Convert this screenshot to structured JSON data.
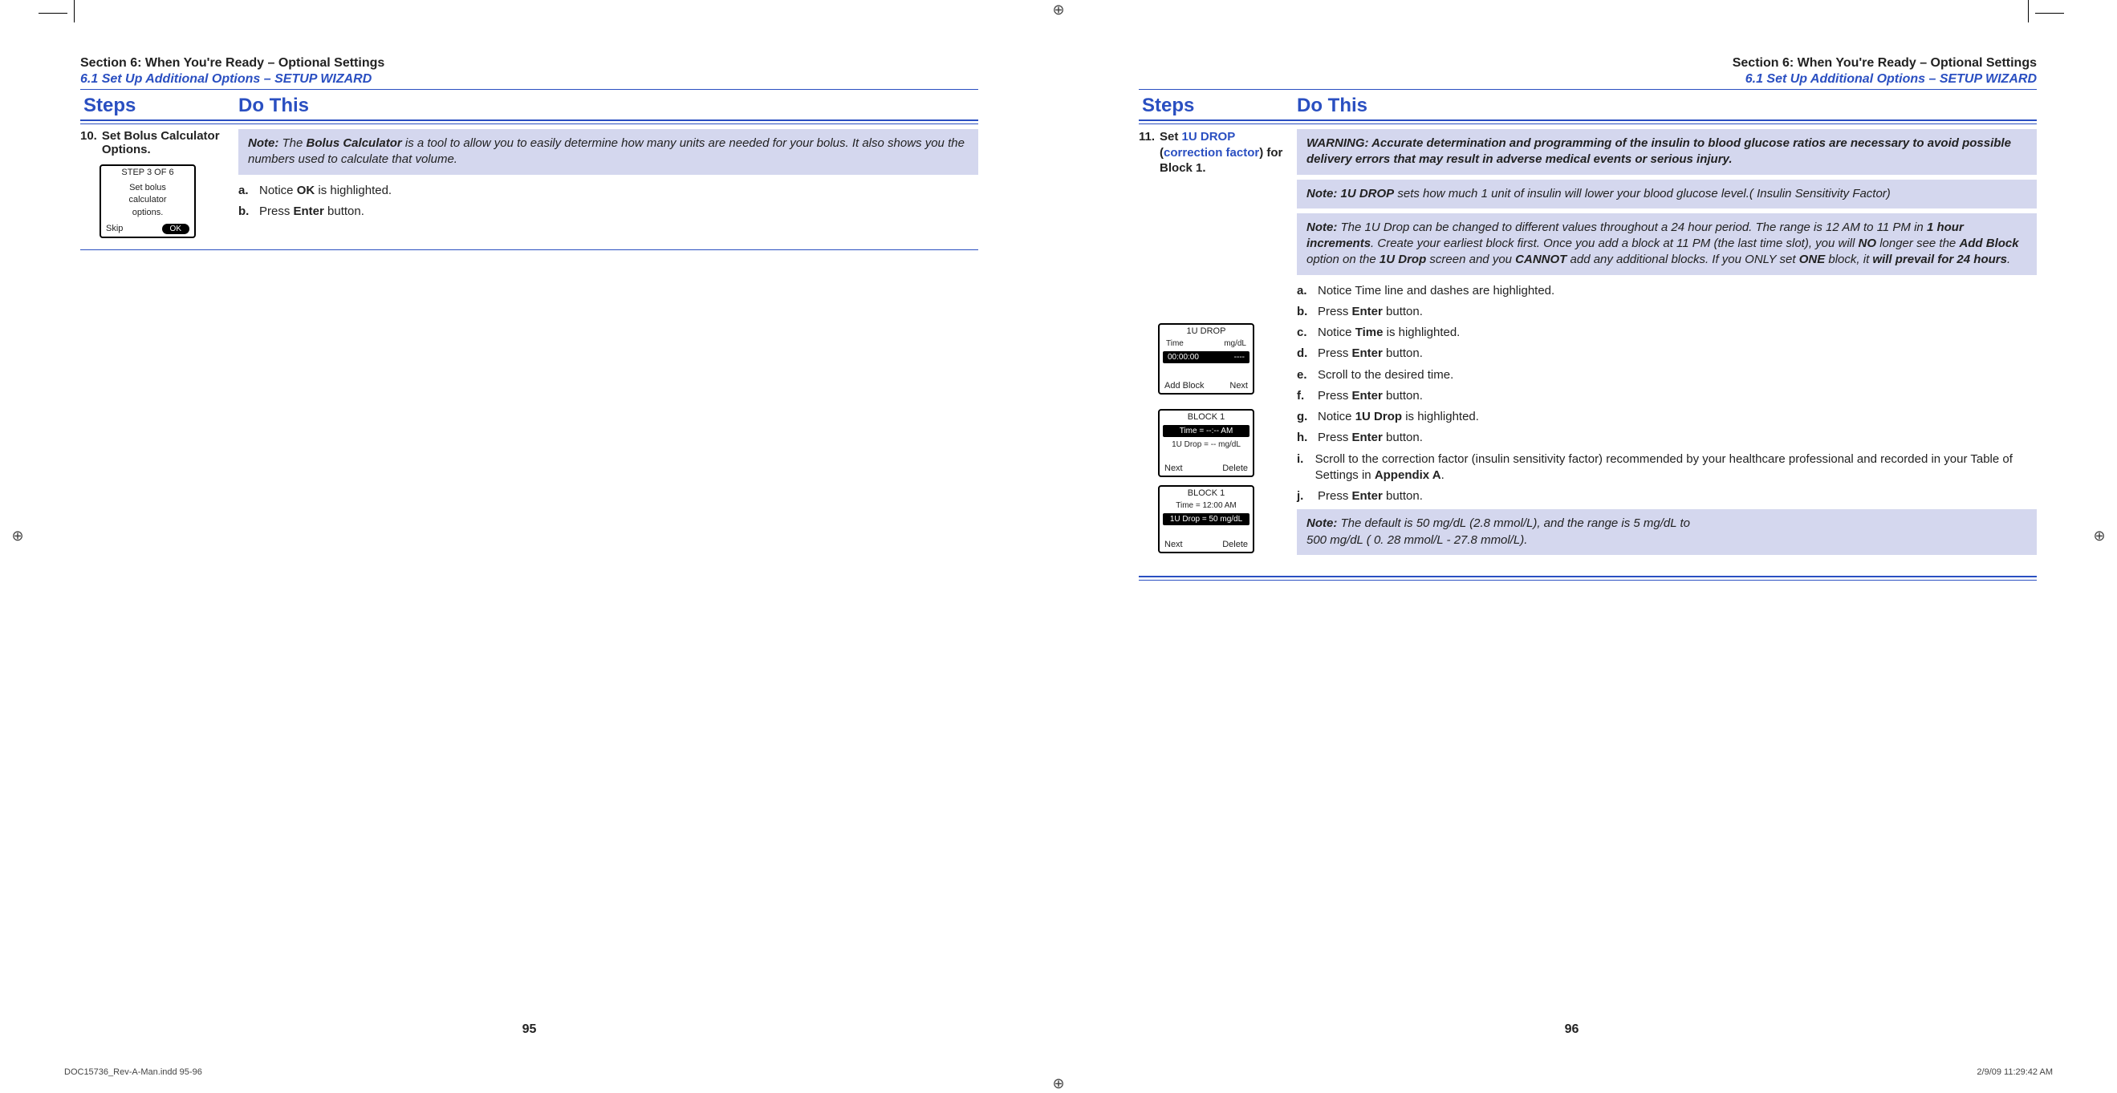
{
  "section": {
    "title": "Section 6: When You're Ready – Optional Settings",
    "subtitle": "6.1 Set Up Additional Options – SETUP WIZARD"
  },
  "headers": {
    "steps": "Steps",
    "dothis": "Do This"
  },
  "page95": {
    "step_num": "10.",
    "step_text_plain": "Set Bolus Calculator Options.",
    "device": {
      "title": "STEP 3 OF 6",
      "line1": "Set bolus",
      "line2": "calculator",
      "line3": "options.",
      "left": "Skip",
      "ok": "OK"
    },
    "note_html": "<b>Note:</b> The <b>Bolus Calculator</b> is a tool to allow you to easily determine how many units are needed for your bolus. It also shows you the numbers used to calculate that volume.",
    "subs": [
      {
        "let": "a.",
        "html": "Notice <b>OK</b> is highlighted."
      },
      {
        "let": "b.",
        "html": "Press <b>Enter</b> button."
      }
    ],
    "page_number": "95"
  },
  "page96": {
    "step_num": "11.",
    "step_text_html": "<b>Set <span class='blue'>1U DROP</span> (<span class='blue'>correction factor</span>) for Block 1.</b>",
    "warn_html": "<b>WARNING: Accurate determination and programming of the insulin to blood glucose ratios are necessary to avoid possible delivery errors that may result in adverse medical events or serious injury.</b>",
    "note2_html": "<b>Note: 1U DROP</b> sets how much 1 unit of insulin will lower your blood glucose level.( Insulin Sensitivity Factor)",
    "note3_html": "<b>Note:</b> The 1U Drop can be changed to different values throughout a 24 hour period. The range is 12 AM to 11 PM in <b>1 hour increments</b>. Create your earliest block first. Once you add a block at 11 PM (the last time slot), you will <b>NO</b> longer see the <b>Add Block</b> option on the <b>1U Drop</b> screen and you <b>CANNOT</b> add any additional blocks. If you ONLY set <b>ONE</b> block, it <b>will prevail for 24 hours</b>.",
    "device1": {
      "title": "1U DROP",
      "h1": "Time",
      "h2": "mg/dL",
      "r1a": "00:00:00",
      "r1b": "----",
      "left": "Add Block",
      "right": "Next"
    },
    "device2": {
      "title": "BLOCK 1",
      "l1": "Time = --:-- AM",
      "l2": "1U Drop = -- mg/dL",
      "left": "Next",
      "right": "Delete"
    },
    "device3": {
      "title": "BLOCK 1",
      "l1": "Time = 12:00 AM",
      "l2": "1U Drop = 50 mg/dL",
      "left": "Next",
      "right": "Delete"
    },
    "subs": [
      {
        "let": "a.",
        "html": "Notice Time line and dashes are highlighted."
      },
      {
        "let": "b.",
        "html": "Press <b>Enter</b> button."
      },
      {
        "let": "c.",
        "html": "Notice <b>Time</b> is highlighted."
      },
      {
        "let": "d.",
        "html": "Press <b>Enter</b> button."
      },
      {
        "let": "e.",
        "html": "Scroll to the desired time."
      },
      {
        "let": "f.",
        "html": "Press <b>Enter</b> button."
      },
      {
        "let": "g.",
        "html": "Notice <b>1U Drop</b> is highlighted."
      },
      {
        "let": "h.",
        "html": "Press <b>Enter</b> button."
      },
      {
        "let": "i.",
        "html": "Scroll to the correction factor (insulin sensitivity factor) recommended by your healthcare professional and recorded in your Table of Settings in <b>Appendix A</b>."
      },
      {
        "let": "j.",
        "html": "Press <b>Enter</b> button."
      }
    ],
    "note4_html": "<b>Note:</b> The default is 50 mg/dL (2.8 mmol/L), and the range is 5 mg/dL to<br>500 mg/dL  ( 0. 28  mmol/L - 27.8 mmol/L).",
    "page_number": "96"
  },
  "slug": {
    "left": "DOC15736_Rev-A-Man.indd   95-96",
    "right": "2/9/09   11:29:42 AM"
  }
}
